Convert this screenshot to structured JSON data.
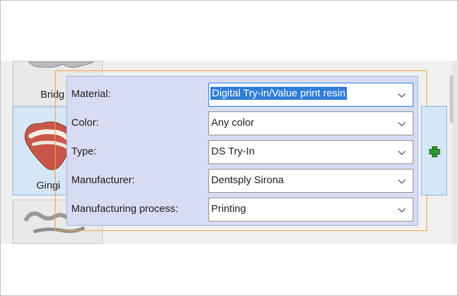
{
  "tiles": [
    {
      "label": "Bridg"
    },
    {
      "label": "Gingi"
    },
    {
      "label": ""
    }
  ],
  "properties": [
    {
      "label": "Material:",
      "value": "Digital Try-in/Value print resin",
      "focused": true
    },
    {
      "label": "Color:",
      "value": "Any color",
      "focused": false
    },
    {
      "label": "Type:",
      "value": "DS Try-In",
      "focused": false
    },
    {
      "label": "Manufacturer:",
      "value": "Dentsply Sirona",
      "focused": false
    },
    {
      "label": "Manufacturing process:",
      "value": "Printing",
      "focused": false
    }
  ],
  "icons": {
    "dropdown": "chevron-down-icon",
    "add": "plus-icon"
  },
  "colors": {
    "panel_bg": "#d8dcf3",
    "selection_border": "#f0a63b",
    "selected_tile": "#d5e6f6",
    "highlight": "#2f7ed8",
    "add_icon": "#2e9a2e"
  }
}
